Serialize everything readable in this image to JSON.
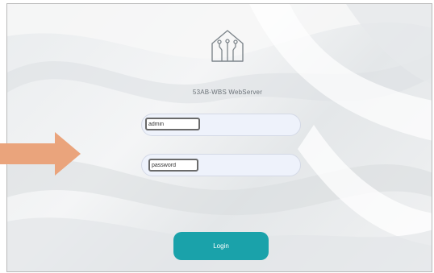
{
  "app": {
    "title": "53AB-WBS WebServer",
    "logo_icon": "house-circuit-icon"
  },
  "login_form": {
    "username_value": "admin",
    "password_value": "password",
    "login_label": "Login"
  },
  "colors": {
    "accent": "#1aa2aa",
    "arrow": "#eaa47c",
    "field_pill": "#eef2fb"
  },
  "annotation": {
    "arrow_icon": "right-arrow-icon"
  }
}
